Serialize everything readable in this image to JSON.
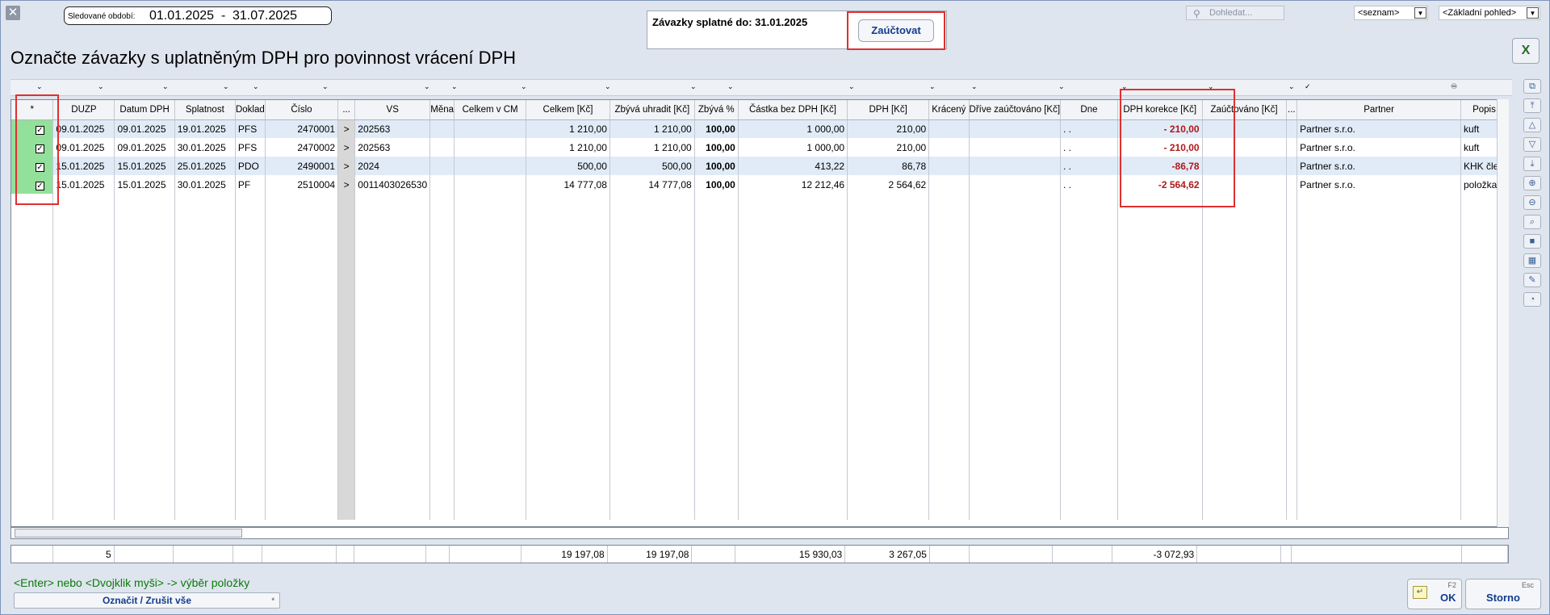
{
  "header": {
    "period_label": "Sledované období:",
    "period_from": "01.01.2025",
    "period_sep": "-",
    "period_to": "31.07.2025",
    "due_label": "Závazky splatné do: 31.01.2025",
    "post_button": "Zaúčtovat",
    "search_placeholder": "Dohledat...",
    "list_select": "<seznam>",
    "view_select": "<Základní pohled>"
  },
  "page_title": "Označte závazky s uplatněným DPH pro povinnost vrácení DPH",
  "columns": [
    "*",
    "DUZP",
    "Datum DPH",
    "Splatnost",
    "Doklad",
    "Číslo",
    "...",
    "VS",
    "Měna",
    "Celkem v CM",
    "Celkem [Kč]",
    "Zbývá uhradit [Kč]",
    "Zbývá %",
    "Částka bez DPH [Kč]",
    "DPH [Kč]",
    "Krácený",
    "Dříve zaúčtováno [Kč]",
    "Dne",
    "DPH korekce [Kč]",
    "Zaúčtováno [Kč]",
    "...",
    "Partner",
    "Popis"
  ],
  "rows": [
    {
      "checked": "✓",
      "duzp": "09.01.2025",
      "datum_dph": "09.01.2025",
      "splatnost": "19.01.2025",
      "doklad": "PFS",
      "cislo": "2470001",
      "arrow": ">",
      "vs": "202563",
      "mena": "",
      "celkem_cm": "",
      "celkem": "1 210,00",
      "zbyva": "1 210,00",
      "zbyva_pct": "100,00",
      "bez_dph": "1 000,00",
      "dph": "210,00",
      "kraceny": "",
      "drive": "",
      "dne": ". .",
      "korekce": "- 210,00",
      "zauctovano": "",
      "extra": "",
      "partner": "Partner s.r.o.",
      "popis": "kuft"
    },
    {
      "checked": "✓",
      "duzp": "09.01.2025",
      "datum_dph": "09.01.2025",
      "splatnost": "30.01.2025",
      "doklad": "PFS",
      "cislo": "2470002",
      "arrow": ">",
      "vs": "202563",
      "mena": "",
      "celkem_cm": "",
      "celkem": "1 210,00",
      "zbyva": "1 210,00",
      "zbyva_pct": "100,00",
      "bez_dph": "1 000,00",
      "dph": "210,00",
      "kraceny": "",
      "drive": "",
      "dne": ". .",
      "korekce": "- 210,00",
      "zauctovano": "",
      "extra": "",
      "partner": "Partner s.r.o.",
      "popis": "kuft"
    },
    {
      "checked": "✓",
      "duzp": "15.01.2025",
      "datum_dph": "15.01.2025",
      "splatnost": "25.01.2025",
      "doklad": "PDO",
      "cislo": "2490001",
      "arrow": ">",
      "vs": "2024",
      "mena": "",
      "celkem_cm": "",
      "celkem": "500,00",
      "zbyva": "500,00",
      "zbyva_pct": "100,00",
      "bez_dph": "413,22",
      "dph": "86,78",
      "kraceny": "",
      "drive": "",
      "dne": ". .",
      "korekce": "-86,78",
      "zauctovano": "",
      "extra": "",
      "partner": "Partner s.r.o.",
      "popis": "KHK člen"
    },
    {
      "checked": "✓",
      "duzp": "15.01.2025",
      "datum_dph": "15.01.2025",
      "splatnost": "30.01.2025",
      "doklad": "PF",
      "cislo": "2510004",
      "arrow": ">",
      "vs": "0011403026530",
      "mena": "",
      "celkem_cm": "",
      "celkem": "14 777,08",
      "zbyva": "14 777,08",
      "zbyva_pct": "100,00",
      "bez_dph": "12 212,46",
      "dph": "2 564,62",
      "kraceny": "",
      "drive": "",
      "dne": ". .",
      "korekce": "-2 564,62",
      "zauctovano": "",
      "extra": "",
      "partner": "Partner s.r.o.",
      "popis": "položka"
    }
  ],
  "totals": {
    "count": "5",
    "celkem": "19 197,08",
    "zbyva": "19 197,08",
    "bez_dph": "15 930,03",
    "dph": "3 267,05",
    "korekce": "-3 072,93"
  },
  "footer": {
    "hint": "<Enter> nebo <Dvojklik myši> -> výběr položky",
    "mark_all": "Označit / Zrušit vše",
    "ok_key": "F2",
    "ok_label": "OK",
    "cancel_key": "Esc",
    "cancel_label": "Storno"
  },
  "colors": {
    "accent_frame": "#e03030",
    "selected_cell": "#93e09a",
    "row_highlight": "#e1ebf8",
    "correction_text": "#b01818",
    "hint_text": "#0b7a0b"
  }
}
